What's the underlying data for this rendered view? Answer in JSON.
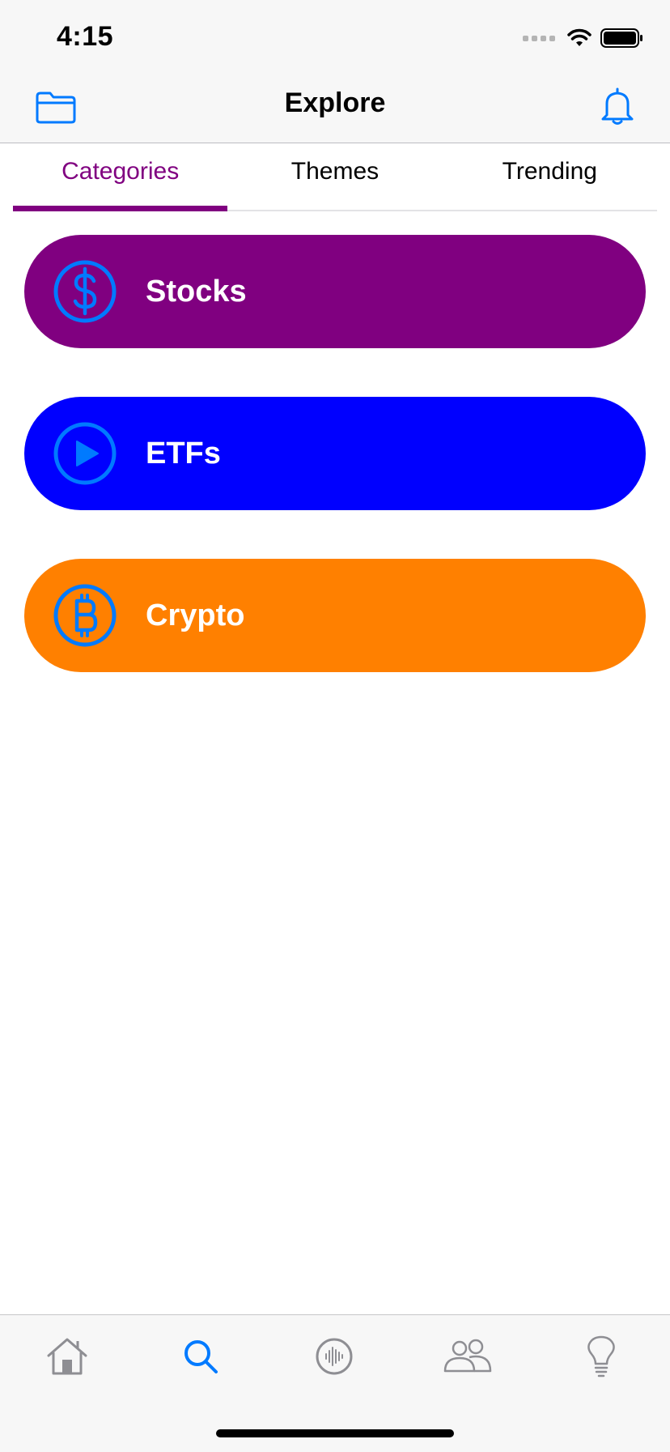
{
  "status_bar": {
    "time": "4:15"
  },
  "nav": {
    "title": "Explore",
    "left_icon": "folder-icon",
    "right_icon": "bell-icon"
  },
  "tabs": [
    {
      "label": "Categories",
      "active": true
    },
    {
      "label": "Themes",
      "active": false
    },
    {
      "label": "Trending",
      "active": false
    }
  ],
  "categories": [
    {
      "label": "Stocks",
      "icon": "dollar-circle-icon",
      "color": "#800080"
    },
    {
      "label": "ETFs",
      "icon": "play-circle-icon",
      "color": "#0000ff"
    },
    {
      "label": "Crypto",
      "icon": "bitcoin-circle-icon",
      "color": "#ff8000"
    }
  ],
  "tabbar": {
    "items": [
      {
        "icon": "home-icon",
        "selected": false
      },
      {
        "icon": "search-icon",
        "selected": true
      },
      {
        "icon": "waveform-circle-icon",
        "selected": false
      },
      {
        "icon": "people-icon",
        "selected": false
      },
      {
        "icon": "lightbulb-icon",
        "selected": false
      }
    ]
  },
  "colors": {
    "accent": "#007aff",
    "tab_active": "#800080",
    "tabbar_inactive": "#8e8e93"
  }
}
